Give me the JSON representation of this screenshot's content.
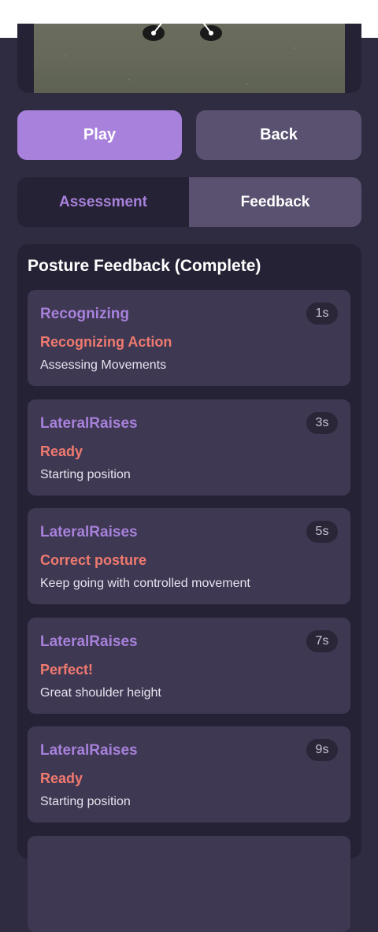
{
  "controls": {
    "play_label": "Play",
    "back_label": "Back"
  },
  "tabs": [
    {
      "label": "Assessment",
      "active": false
    },
    {
      "label": "Feedback",
      "active": true
    }
  ],
  "feedback": {
    "title": "Posture Feedback (Complete)",
    "items": [
      {
        "exercise": "Recognizing",
        "status": "Recognizing Action",
        "description": "Assessing Movements",
        "time": "1s"
      },
      {
        "exercise": "LateralRaises",
        "status": "Ready",
        "description": "Starting position",
        "time": "3s"
      },
      {
        "exercise": "LateralRaises",
        "status": "Correct posture",
        "description": "Keep going with controlled movement",
        "time": "5s"
      },
      {
        "exercise": "LateralRaises",
        "status": "Perfect!",
        "description": "Great shoulder height",
        "time": "7s"
      },
      {
        "exercise": "LateralRaises",
        "status": "Ready",
        "description": "Starting position",
        "time": "9s"
      }
    ]
  },
  "colors": {
    "accent": "#a781db",
    "status": "#f07a6f",
    "background": "#2f2b40",
    "card": "#3e3852"
  }
}
